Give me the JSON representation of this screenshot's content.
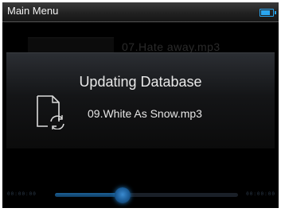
{
  "titlebar": {
    "title": "Main Menu"
  },
  "background": {
    "track_text": "07.Hate away.mp3"
  },
  "dialog": {
    "heading": "Updating Database",
    "filename": "09.White As Snow.mp3",
    "icon": "document-refresh-icon"
  },
  "seekbar": {
    "time_left": "00:00:00",
    "time_right": "00:00:00",
    "progress_fraction": 0.37
  },
  "colors": {
    "accent": "#2aa6f0",
    "background": "#000000"
  }
}
